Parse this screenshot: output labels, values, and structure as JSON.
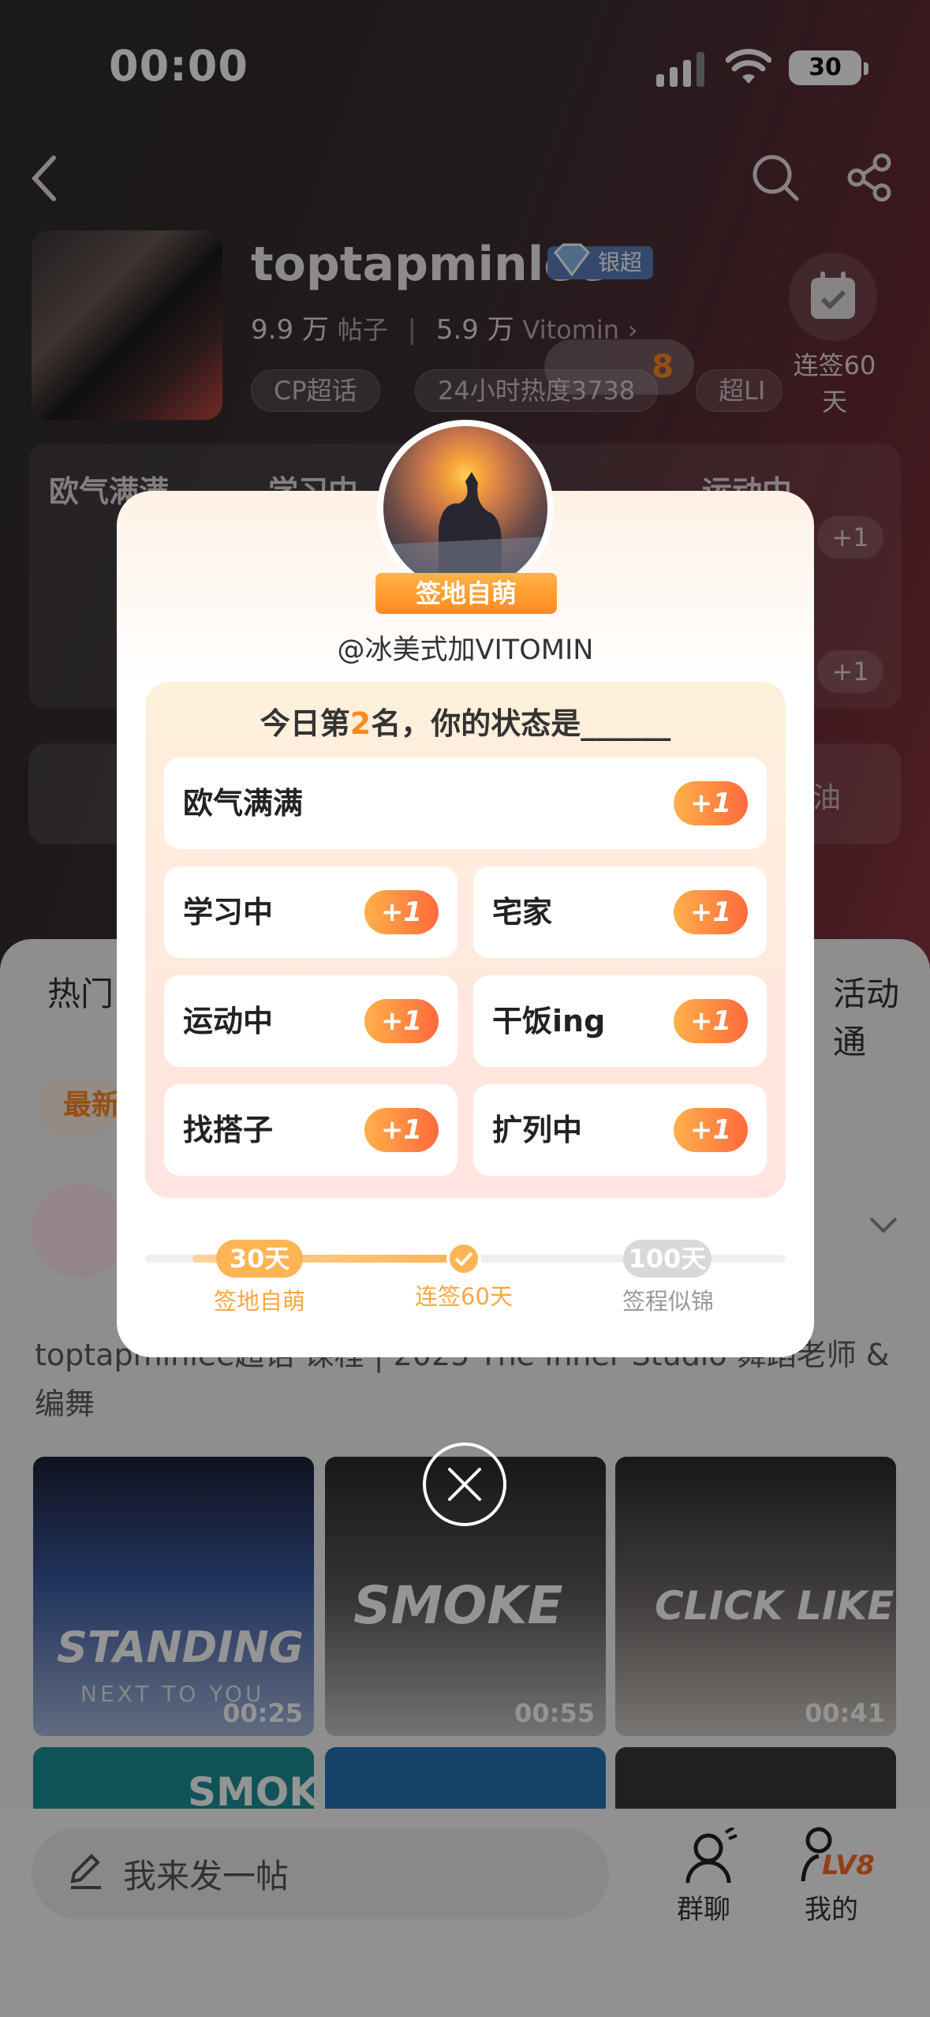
{
  "status_bar": {
    "time": "00:00",
    "battery": "30"
  },
  "community": {
    "name": "toptapminlee",
    "badge": "银超",
    "posts_count": "9.9 万",
    "posts_label": "帖子",
    "vitomin_count": "5.9 万",
    "vitomin_label": "Vitomin",
    "tags": [
      "CP超话",
      "24小时热度3738",
      "超LI"
    ],
    "checkin_label": "连签60天",
    "lv_chip": "8"
  },
  "bg_grid": {
    "cells": [
      "欧气满满",
      "学习中",
      "运动中"
    ],
    "plus": "+1",
    "right_text": "油"
  },
  "tabs": {
    "left": "热门",
    "right": "活动通",
    "filter": "最新"
  },
  "feed": {
    "post_text": "toptapminlee超话 课程 | 2025 The Inner Studio 舞蹈老师 & 编舞",
    "videos": [
      {
        "title": "STANDING",
        "subtitle": "NEXT TO YOU",
        "duration": "00:25"
      },
      {
        "title": "SMOKE",
        "subtitle": "",
        "duration": "00:55"
      },
      {
        "title": "CLICK LIKE",
        "subtitle": "",
        "duration": "00:41"
      }
    ],
    "next_row_title": "SMOKE"
  },
  "modal": {
    "ribbon": "签地自萌",
    "handle": "@冰美式加VITOMIN",
    "question_prefix": "今日第",
    "rank": "2",
    "question_suffix": "名，你的状态是______",
    "plus_label": "+1",
    "options": [
      "欧气满满",
      "学习中",
      "宅家",
      "运动中",
      "干饭ing",
      "找搭子",
      "扩列中"
    ],
    "milestones": [
      {
        "value": "30天",
        "label": "签地自萌"
      },
      {
        "value": "",
        "label": "连签60天"
      },
      {
        "value": "100天",
        "label": "签程似锦"
      }
    ]
  },
  "bottom_bar": {
    "compose_placeholder": "我来发一帖",
    "group_chat": "群聊",
    "mine": "我的",
    "level": "LV8"
  }
}
